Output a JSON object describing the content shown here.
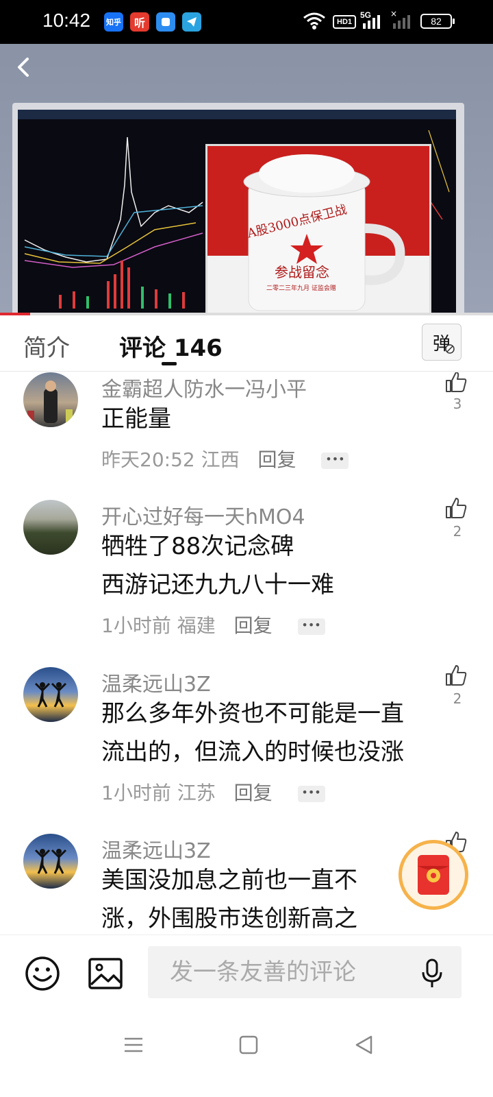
{
  "status_bar": {
    "time": "10:42",
    "apps": [
      {
        "name": "zhihu",
        "label": "知乎",
        "color": "#1772f6"
      },
      {
        "name": "ting",
        "label": "听",
        "color": "#e53a2e"
      },
      {
        "name": "browser",
        "label": "",
        "color": "#2d8cf0"
      },
      {
        "name": "telegram",
        "label": "",
        "color": "#2aa3e0"
      }
    ],
    "hd": "HD1",
    "network": "5G",
    "battery": "82"
  },
  "video": {
    "cup_line1": "A股3000点保卫战",
    "cup_line2": "参战留念",
    "cup_line3": "二零二三年九月 证监会赠"
  },
  "tabs": {
    "intro": "简介",
    "comments": "评论",
    "comment_count": "146",
    "danmaku": "弹"
  },
  "comments": [
    {
      "user": "金霸超人防水一冯小平",
      "lines": [
        "正能量"
      ],
      "time": "昨天20:52",
      "location": "江西",
      "reply": "回复",
      "likes": "3"
    },
    {
      "user": "开心过好每一天hMO4",
      "lines": [
        "牺牲了88次记念碑",
        "西游记还九九八十一难"
      ],
      "time": "1小时前",
      "location": "福建",
      "reply": "回复",
      "likes": "2"
    },
    {
      "user": "温柔远山3Z",
      "lines": [
        "那么多年外资也不可能是一直",
        "流出的，但流入的时候也没涨"
      ],
      "time": "1小时前",
      "location": "江苏",
      "reply": "回复",
      "likes": "2"
    },
    {
      "user": "温柔远山3Z",
      "lines": [
        "美国没加息之前也一直不",
        "涨，外围股市迭创新高之"
      ],
      "time": "",
      "location": "",
      "reply": "",
      "likes": ""
    }
  ],
  "input": {
    "placeholder": "发一条友善的评论"
  }
}
